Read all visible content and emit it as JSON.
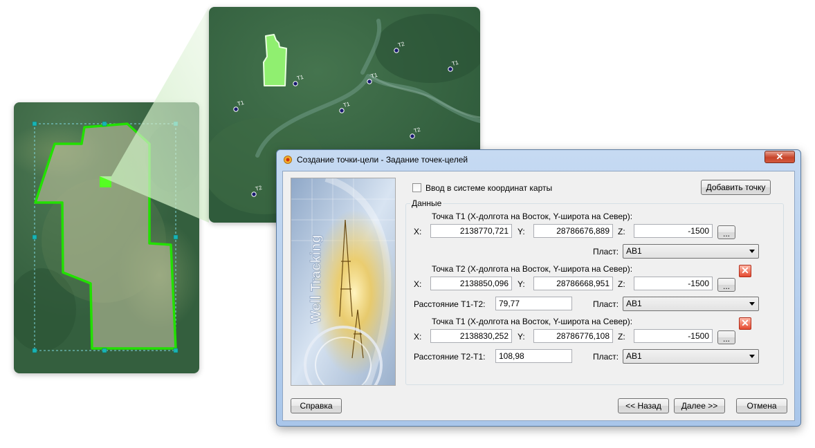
{
  "map_top": {
    "markers": [
      {
        "label": "T2",
        "pos": [
          271,
          63
        ]
      },
      {
        "label": "T1",
        "pos": [
          125,
          111
        ]
      },
      {
        "label": "T1",
        "pos": [
          232,
          108
        ]
      },
      {
        "label": "T1",
        "pos": [
          349,
          90
        ]
      },
      {
        "label": "T1",
        "pos": [
          39,
          148
        ]
      },
      {
        "label": "T1",
        "pos": [
          192,
          150
        ]
      },
      {
        "label": "T2",
        "pos": [
          294,
          187
        ]
      },
      {
        "label": "T2",
        "pos": [
          65,
          271
        ]
      }
    ]
  },
  "dialog": {
    "title": "Создание точки-цели - Задание точек-целей",
    "close_label": "✕",
    "banner_text": "Well Tracking",
    "map_coords_label": "Ввод в системе координат карты",
    "add_point_label": "Добавить точку",
    "group_title": "Данные",
    "points": [
      {
        "header": "Точка T1  (X-долгота на Восток, Y-широта на Север):",
        "x_label": "X:",
        "x": "2138770,721",
        "y_label": "Y:",
        "y": "28786676,889",
        "z_label": "Z:",
        "z": "-1500",
        "browse": "...",
        "layer_label": "Пласт:",
        "layer": "AB1"
      },
      {
        "header": "Точка T2  (X-долгота на Восток, Y-широта на Север):",
        "x_label": "X:",
        "x": "2138850,096",
        "y_label": "Y:",
        "y": "28786668,951",
        "z_label": "Z:",
        "z": "-1500",
        "browse": "...",
        "delete": "✕",
        "distance_label": "Расстояние T1-T2:",
        "distance": "79,77",
        "layer_label": "Пласт:",
        "layer": "AB1"
      },
      {
        "header": "Точка T1  (X-долгота на Восток, Y-широта на Север):",
        "x_label": "X:",
        "x": "2138830,252",
        "y_label": "Y:",
        "y": "28786776,108",
        "z_label": "Z:",
        "z": "-1500",
        "browse": "...",
        "delete": "✕",
        "distance_label": "Расстояние T2-T1:",
        "distance": "108,98",
        "layer_label": "Пласт:",
        "layer": "AB1"
      }
    ],
    "buttons": {
      "help": "Справка",
      "back": "<< Назад",
      "next": "Далее >>",
      "cancel": "Отмена"
    }
  },
  "colors": {
    "accent_green": "#22e000",
    "forest": "#3c6e48",
    "marker": "#1a1a70",
    "selection_handle": "#17b5b5"
  }
}
